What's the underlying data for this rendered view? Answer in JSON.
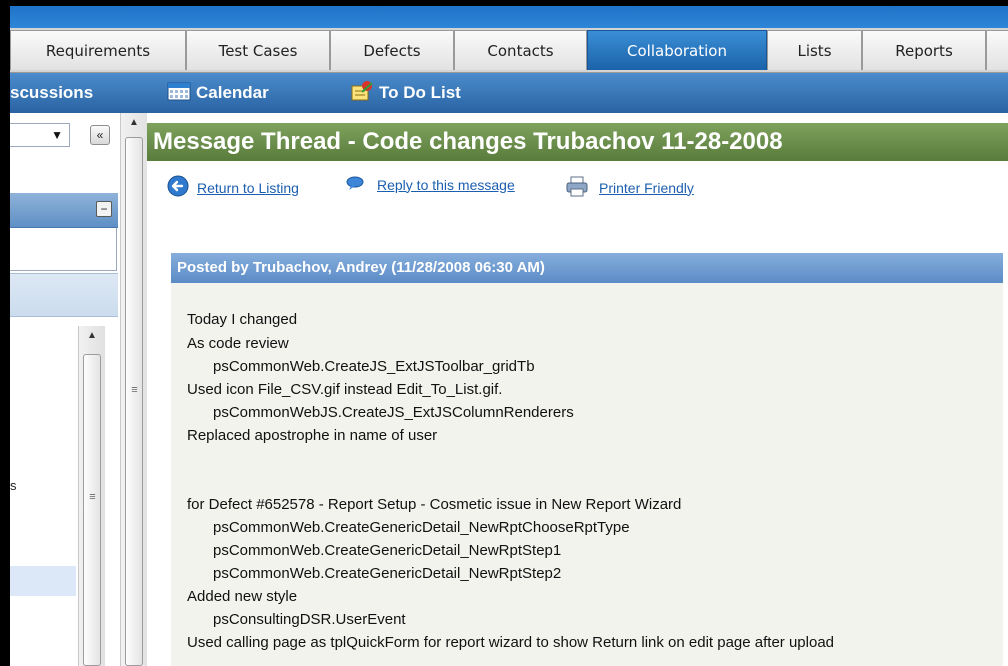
{
  "tabs": [
    {
      "label": "Requirements",
      "active": false
    },
    {
      "label": "Test Cases",
      "active": false
    },
    {
      "label": "Defects",
      "active": false
    },
    {
      "label": "Contacts",
      "active": false
    },
    {
      "label": "Collaboration",
      "active": true
    },
    {
      "label": "Lists",
      "active": false
    },
    {
      "label": "Reports",
      "active": false
    }
  ],
  "subnav": {
    "discussions": "scussions",
    "calendar": "Calendar",
    "todo": "To Do List"
  },
  "left_panel": {
    "collapse_glyph": "«",
    "list_fragment": "s"
  },
  "page_title": "Message Thread - Code changes Trubachov 11-28-2008",
  "actions": {
    "return": "Return to Listing",
    "reply": "Reply to this message",
    "print": "Printer Friendly"
  },
  "post": {
    "header": "Posted by Trubachov, Andrey (11/28/2008 06:30 AM)",
    "lines": [
      {
        "text": "Today I changed",
        "indent": false
      },
      {
        "text": "As code review",
        "indent": false
      },
      {
        "text": "psCommonWeb.CreateJS_ExtJSToolbar_gridTb",
        "indent": true
      },
      {
        "text": "Used icon File_CSV.gif instead Edit_To_List.gif.",
        "indent": false
      },
      {
        "text": "psCommonWebJS.CreateJS_ExtJSColumnRenderers",
        "indent": true
      },
      {
        "text": "Replaced apostrophe in name of user",
        "indent": false
      },
      {
        "text": "",
        "indent": false
      },
      {
        "text": "",
        "indent": false
      },
      {
        "text": "for Defect #652578 - Report Setup - Cosmetic issue in New Report Wizard",
        "indent": false
      },
      {
        "text": "psCommonWeb.CreateGenericDetail_NewRptChooseRptType",
        "indent": true
      },
      {
        "text": "psCommonWeb.CreateGenericDetail_NewRptStep1",
        "indent": true
      },
      {
        "text": "psCommonWeb.CreateGenericDetail_NewRptStep2",
        "indent": true
      },
      {
        "text": "Added new style",
        "indent": false
      },
      {
        "text": "psConsultingDSR.UserEvent",
        "indent": true
      },
      {
        "text": "Used calling page as tplQuickForm for report wizard to show Return link on edit page after upload",
        "indent": false
      }
    ]
  },
  "colors": {
    "active_tab": "#1b62a9",
    "subnav": "#2a63a4",
    "title_bar": "#587c3b",
    "post_header": "#5b8bc6",
    "link": "#1c5fb0"
  }
}
